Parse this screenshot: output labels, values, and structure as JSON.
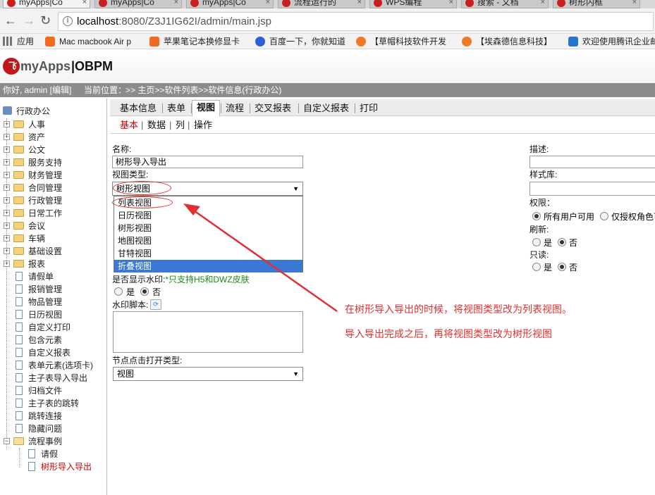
{
  "browser": {
    "tabs": [
      {
        "label": "myApps|Co"
      },
      {
        "label": "myApps|Co"
      },
      {
        "label": "myApps|Co"
      },
      {
        "label": "流程运行的"
      },
      {
        "label": "WPS编程"
      },
      {
        "label": "搜索 - 文档"
      },
      {
        "label": "树形内框"
      }
    ],
    "url_host": "localhost",
    "url_rest": ":8080/Z3J1IG62I/admin/main.jsp",
    "bookmarks": [
      {
        "label": "应用",
        "icon": "apps-grid-icon"
      },
      {
        "label": "Mac macbook Air p",
        "icon": "taobao-icon"
      },
      {
        "label": "苹果笔记本换修显卡",
        "icon": "taobao-icon"
      },
      {
        "label": "百度一下，你就知道",
        "icon": "baidu-paw-icon"
      },
      {
        "label": "【草帽科技软件开发",
        "icon": "bookmark-orange-icon"
      },
      {
        "label": "【埃森德信息科技】",
        "icon": "bookmark-orange-icon"
      },
      {
        "label": "欢迎使用腾讯企业邮",
        "icon": "tencent-mail-icon"
      }
    ]
  },
  "app": {
    "logo_text1": "myApps",
    "logo_text2": "|OBPM",
    "logo_mark": "飞",
    "greeting": "你好, admin [编辑]",
    "location_label": "当前位置：",
    "location_path": ">> 主页>>软件列表>>软件信息(行政办公)"
  },
  "tree": {
    "root": "行政办公",
    "folders": [
      "人事",
      "资产",
      "公文",
      "服务支持",
      "财务管理",
      "合同管理",
      "行政管理",
      "日常工作",
      "会议",
      "车辆",
      "基础设置",
      "报表"
    ],
    "docs": [
      "请假单",
      "报销管理",
      "物品管理",
      "日历视图",
      "自定义打印",
      "包含元素",
      "自定义报表",
      "表单元素(选项卡)",
      "主子表导入导出",
      "归档文件",
      "主子表的跳转",
      "跳转连接",
      "隐藏问题"
    ],
    "open_folder": "流程事例",
    "sub_docs": [
      "请假",
      "树形导入导出"
    ],
    "selected": "树形导入导出"
  },
  "tabs_main": [
    "基本信息",
    "表单",
    "视图",
    "流程",
    "交叉报表",
    "自定义报表",
    "打印"
  ],
  "tabs_main_active": "视图",
  "tabs_sub": [
    "基本",
    "数据",
    "列",
    "操作"
  ],
  "tabs_sub_active": "基本",
  "tabs_sub_sep": "|",
  "form": {
    "name_label": "名称:",
    "name_value": "树形导入导出",
    "viewtype_label": "视图类型:",
    "viewtype_value": "树形视图",
    "viewtype_options": [
      "列表视图",
      "日历视图",
      "树形视图",
      "地图视图",
      "甘特视图",
      "折叠视图"
    ],
    "viewtype_highlighted": "折叠视图",
    "watermark_label": "是否显示水印:",
    "watermark_note": "*只支持H5和DWZ皮肤",
    "yes": "是",
    "no": "否",
    "watermark_script_label": "水印脚本:",
    "node_click_label": "节点点击打开类型:",
    "node_click_value": "视图",
    "desc_label": "描述:",
    "style_label": "样式库:",
    "perm_label": "权限：",
    "perm_all": "所有用户可用",
    "perm_role": "仅授权角色可",
    "refresh_label": "刷新:",
    "readonly_label": "只读:"
  },
  "annotation": {
    "line1": "在树形导入导出的时候，将视图类型改为列表视图。",
    "line2": "导入导出完成之后，再将视图类型改为树形视图",
    "color": "#e03030"
  }
}
